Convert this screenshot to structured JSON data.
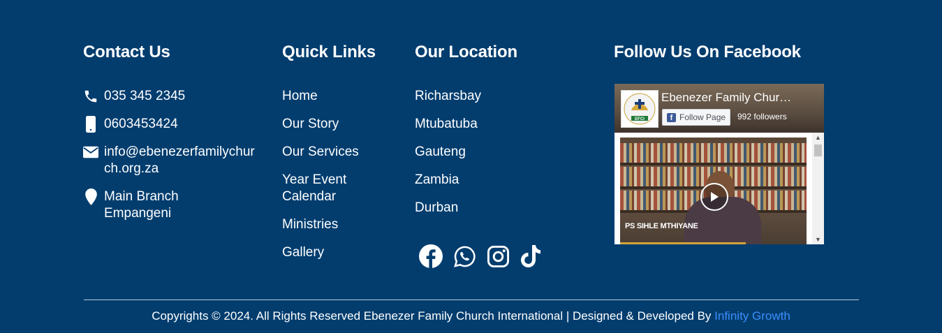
{
  "contact": {
    "heading": "Contact Us",
    "items": [
      {
        "icon": "phone-icon",
        "text": "035 345 2345"
      },
      {
        "icon": "mobile-icon",
        "text": "0603453424"
      },
      {
        "icon": "envelope-icon",
        "text": "info@ebenezerfamilychurch.org.za"
      },
      {
        "icon": "map-marker-icon",
        "text": "Main Branch Empangeni"
      }
    ]
  },
  "quick_links": {
    "heading": "Quick Links",
    "items": [
      "Home",
      "Our Story",
      "Our Services",
      "Year Event Calendar",
      "Ministries",
      "Gallery"
    ]
  },
  "location": {
    "heading": "Our Location",
    "items": [
      "Richarsbay",
      "Mtubatuba",
      "Gauteng",
      "Zambia",
      "Durban"
    ],
    "social_icons": [
      "facebook-icon",
      "whatsapp-icon",
      "instagram-icon",
      "tiktok-icon"
    ]
  },
  "facebook": {
    "heading": "Follow Us On Facebook",
    "page_name": "Ebenezer Family Chur…",
    "follow_label": "Follow Page",
    "followers": "992 followers",
    "logo_text": "EFCI",
    "video_caption": "PS SIHLE MTHIYANE"
  },
  "footer": {
    "copyright": "Copyrights © 2024. All Rights Reserved Ebenezer Family Church International | Designed & Developed By ",
    "credit_link": "Infinity Growth"
  },
  "colors": {
    "background": "#023d6e",
    "link_accent": "#3b8fff"
  }
}
